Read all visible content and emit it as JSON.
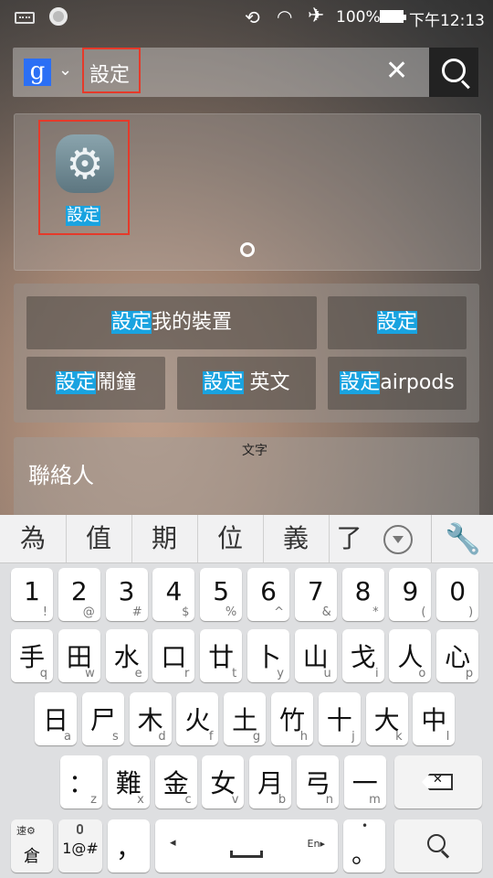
{
  "status": {
    "battery": "100%",
    "time": "下午12:13"
  },
  "search": {
    "query": "設定"
  },
  "app": {
    "label": "設定"
  },
  "suggestions": [
    {
      "hl": "設定",
      "rest": "我的裝置"
    },
    {
      "hl": "設定",
      "rest": ""
    },
    {
      "hl": "設定",
      "rest": "鬧鐘"
    },
    {
      "hl": "設定",
      "rest": " 英文"
    },
    {
      "hl": "設定",
      "rest": "airpods"
    }
  ],
  "contacts": {
    "placeholder": "文字",
    "title": "聯絡人"
  },
  "candidates": [
    "為",
    "值",
    "期",
    "位",
    "義",
    "了"
  ],
  "keyboard": {
    "row1": [
      {
        "m": "1",
        "s": "!"
      },
      {
        "m": "2",
        "s": "@"
      },
      {
        "m": "3",
        "s": "#"
      },
      {
        "m": "4",
        "s": "$"
      },
      {
        "m": "5",
        "s": "%"
      },
      {
        "m": "6",
        "s": "^"
      },
      {
        "m": "7",
        "s": "&"
      },
      {
        "m": "8",
        "s": "*"
      },
      {
        "m": "9",
        "s": "("
      },
      {
        "m": "0",
        "s": ")"
      }
    ],
    "row2": [
      {
        "m": "手",
        "s": "q"
      },
      {
        "m": "田",
        "s": "w"
      },
      {
        "m": "水",
        "s": "e"
      },
      {
        "m": "口",
        "s": "r"
      },
      {
        "m": "廿",
        "s": "t"
      },
      {
        "m": "卜",
        "s": "y"
      },
      {
        "m": "山",
        "s": "u"
      },
      {
        "m": "戈",
        "s": "i"
      },
      {
        "m": "人",
        "s": "o"
      },
      {
        "m": "心",
        "s": "p"
      }
    ],
    "row3": [
      {
        "m": "日",
        "s": "a"
      },
      {
        "m": "尸",
        "s": "s"
      },
      {
        "m": "木",
        "s": "d"
      },
      {
        "m": "火",
        "s": "f"
      },
      {
        "m": "土",
        "s": "g"
      },
      {
        "m": "竹",
        "s": "h"
      },
      {
        "m": "十",
        "s": "j"
      },
      {
        "m": "大",
        "s": "k"
      },
      {
        "m": "中",
        "s": "l"
      }
    ],
    "row4": [
      {
        "m": "：",
        "s": "z"
      },
      {
        "m": "難",
        "s": "x"
      },
      {
        "m": "金",
        "s": "c"
      },
      {
        "m": "女",
        "s": "v"
      },
      {
        "m": "月",
        "s": "b"
      },
      {
        "m": "弓",
        "s": "n"
      },
      {
        "m": "一",
        "s": "m"
      }
    ],
    "lang_key": "倉",
    "lang_small": "速",
    "sym_key": "1@#",
    "comma": "，",
    "space_lang": "En▸",
    "period": "。"
  }
}
